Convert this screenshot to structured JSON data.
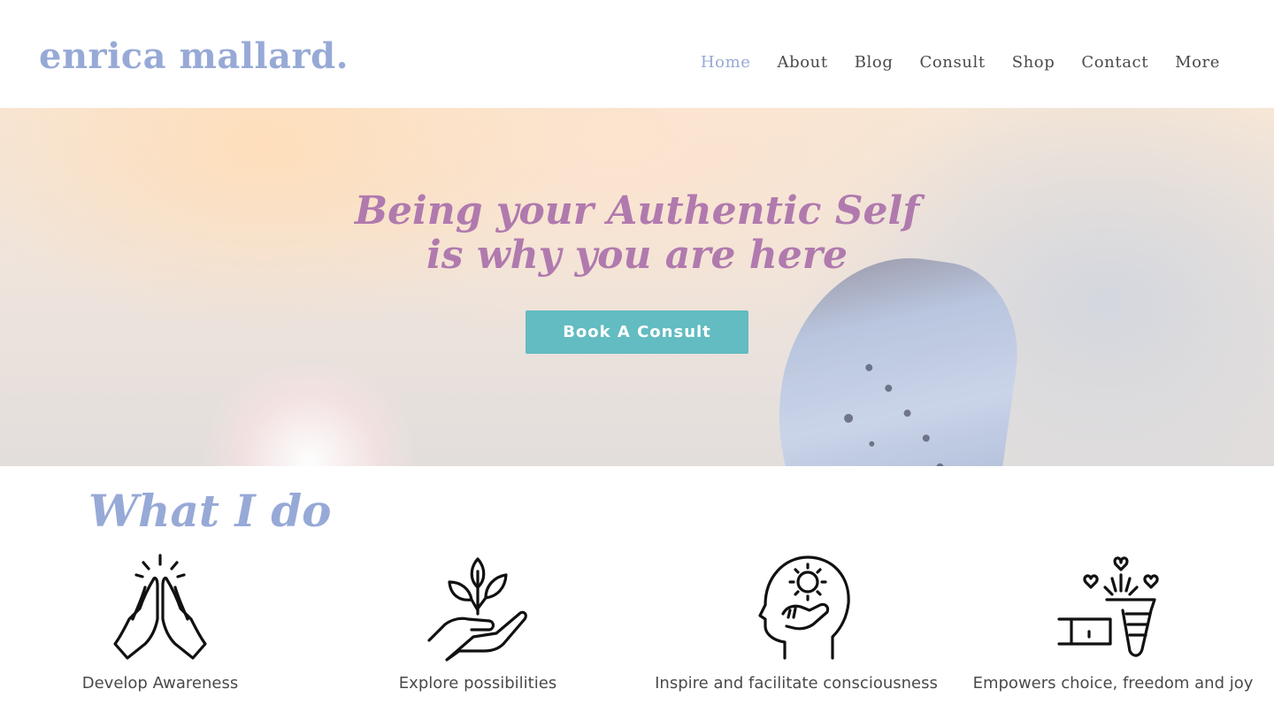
{
  "brand": {
    "logo": "enrica mallard.",
    "logo_color": "#97a9d6",
    "accent": "#62bcc1",
    "title_color": "#b07aae"
  },
  "nav": {
    "items": [
      {
        "label": "Home",
        "active": true
      },
      {
        "label": "About"
      },
      {
        "label": "Blog"
      },
      {
        "label": "Consult"
      },
      {
        "label": "Shop"
      },
      {
        "label": "Contact"
      },
      {
        "label": "More"
      }
    ]
  },
  "hero": {
    "title_line1": "Being your Authentic Self",
    "title_line2": "is why you are here",
    "cta_label": "Book A Consult"
  },
  "what_i_do": {
    "title": "What I do",
    "items": [
      {
        "icon": "praying-hands-icon",
        "label": "Develop Awareness"
      },
      {
        "icon": "hand-sprout-icon",
        "label": "Explore possibilities"
      },
      {
        "icon": "head-sun-icon",
        "label": "Inspire and facilitate consciousness"
      },
      {
        "icon": "gift-hearts-icon",
        "label": "Empowers choice, freedom and joy"
      }
    ]
  }
}
